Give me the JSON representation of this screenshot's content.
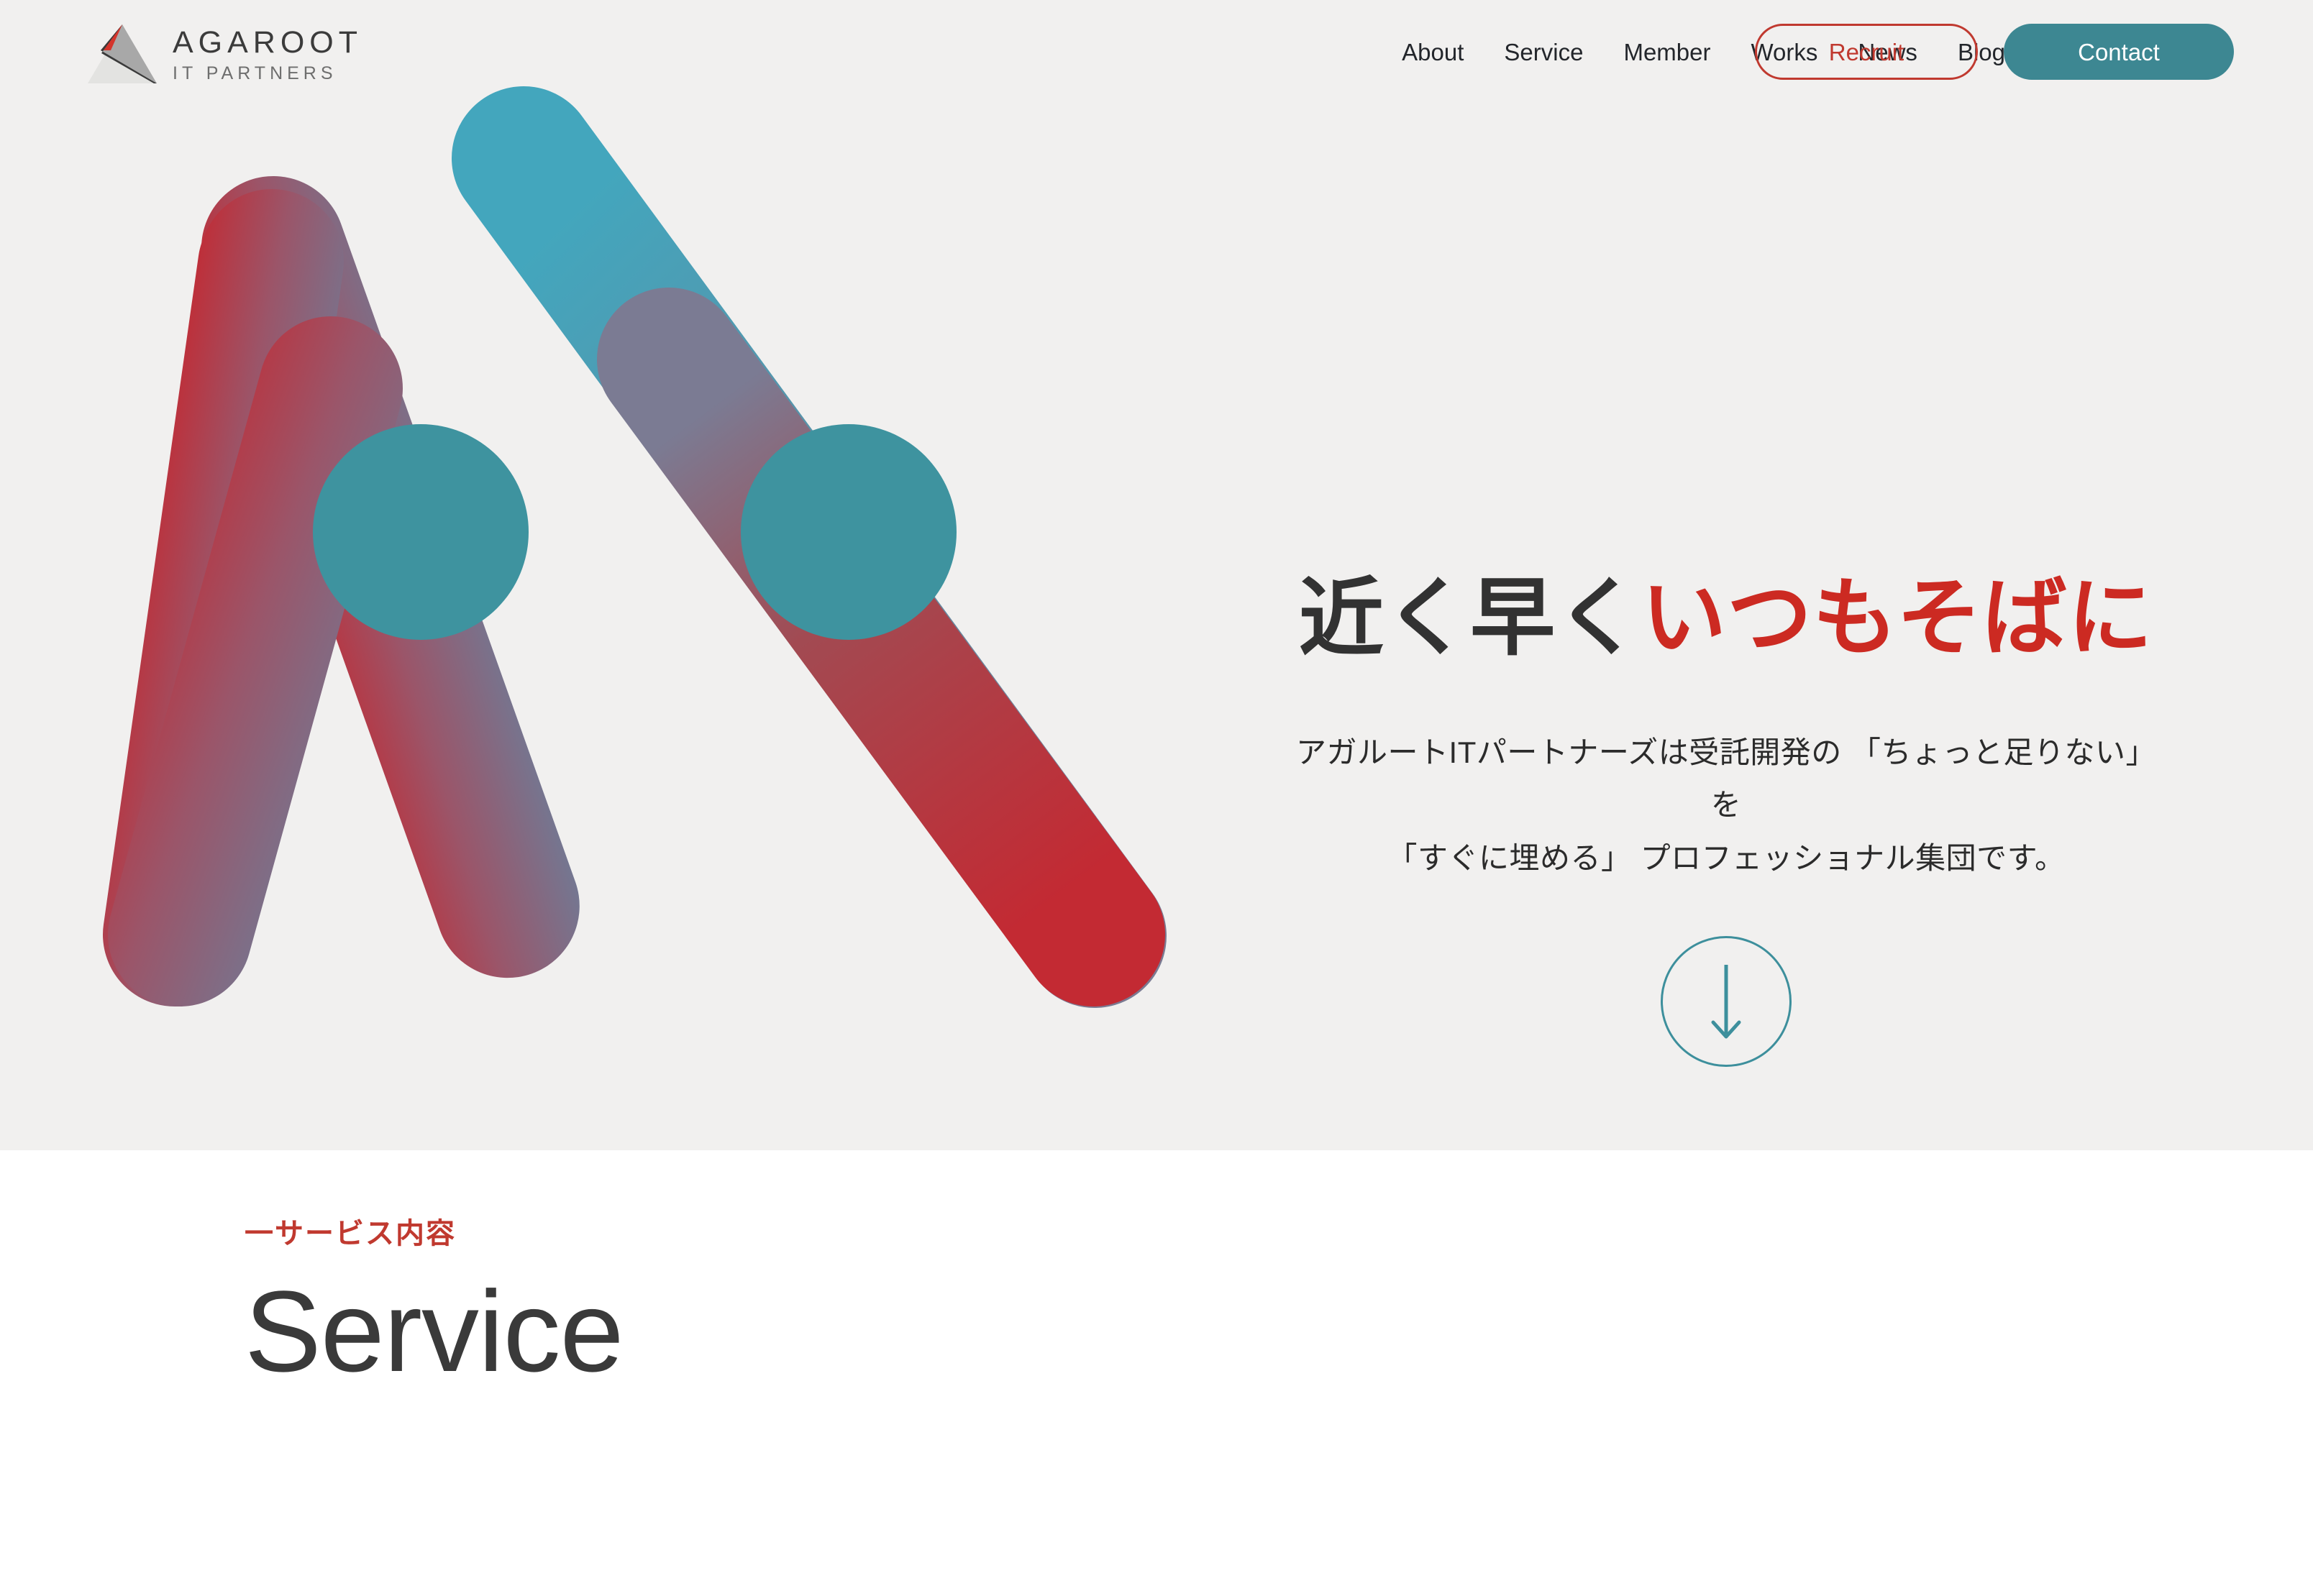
{
  "brand": {
    "name": "AGAROOT",
    "subtitle": "IT PARTNERS",
    "mark_icon": "agaroot-triangle-logo-icon"
  },
  "header": {
    "nav": [
      {
        "label": "About"
      },
      {
        "label": "Service"
      },
      {
        "label": "Member"
      },
      {
        "label": "Works"
      },
      {
        "label": "News"
      },
      {
        "label": "Blog"
      }
    ],
    "recruit_button": "Recruit",
    "contact_button": "Contact"
  },
  "hero": {
    "title_dark": "近く早く",
    "title_accent": "いつもそばに",
    "lead_line1": "アガルートITパートナーズは受託開発の 「ちょっと足りない」 を",
    "lead_line2": "「すぐに埋める」 プロフェッショナル集団です。",
    "scroll_icon": "arrow-down-icon",
    "graphic_icon": "rounded-triangle-graphic-icon"
  },
  "service": {
    "eyebrow": "一サービス内容",
    "heading": "Service"
  },
  "colors": {
    "hero_background": "#f1f0ef",
    "page_background": "#ffffff",
    "accent_red": "#c0392f",
    "accent_teal": "#3d8792",
    "heading_dark": "#3a3a3a",
    "title_accent_red": "#cc2a22",
    "graphic_teal": "#43a6bd",
    "graphic_red": "#c32a33",
    "graphic_mid_gray": "#77798f",
    "circle_teal": "#3e939f"
  }
}
